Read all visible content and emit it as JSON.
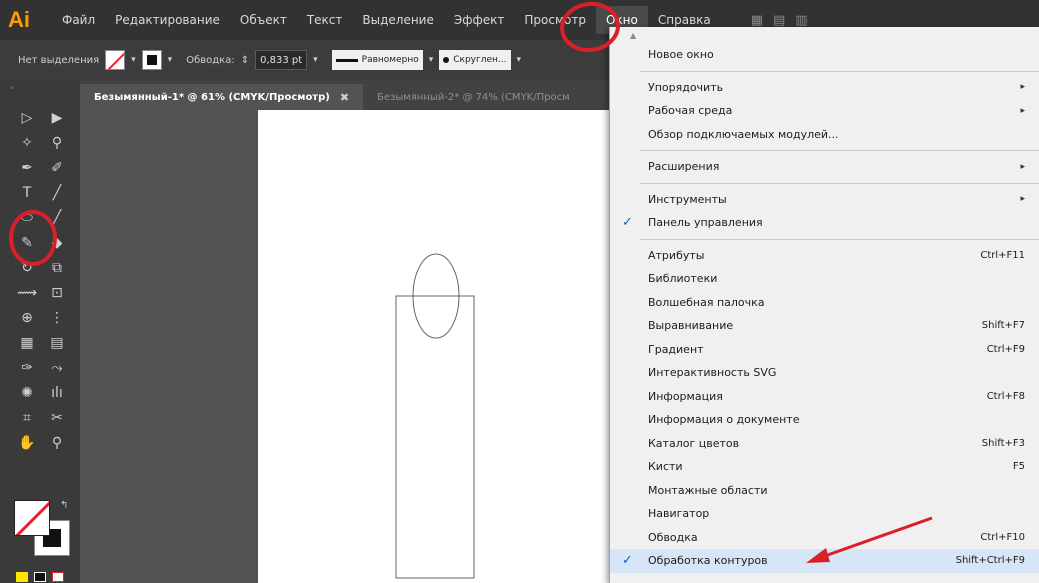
{
  "app": {
    "logo": "Ai"
  },
  "menubar": {
    "items": [
      {
        "label": "Файл",
        "active": false
      },
      {
        "label": "Редактирование",
        "active": false
      },
      {
        "label": "Объект",
        "active": false
      },
      {
        "label": "Текст",
        "active": false
      },
      {
        "label": "Выделение",
        "active": false
      },
      {
        "label": "Эффект",
        "active": false
      },
      {
        "label": "Просмотр",
        "active": false
      },
      {
        "label": "Окно",
        "active": true
      },
      {
        "label": "Справка",
        "active": false
      }
    ]
  },
  "controlbar": {
    "selection_label": "Нет выделения",
    "stroke_label": "Обводка:",
    "stroke_value": "0,833 pt",
    "profile_label": "Равномерно",
    "brush_label": "Скруглен..."
  },
  "tabs": [
    {
      "label": "Безымянный-1* @ 61% (CMYK/Просмотр)",
      "active": true,
      "close": "✖"
    },
    {
      "label": "Безымянный-2* @ 74% (CMYK/Просм",
      "active": false,
      "close": ""
    }
  ],
  "tools": {
    "grip": "\"",
    "rows": [
      {
        "left": "▷",
        "left_name": "selection-tool-icon",
        "right": "▶",
        "right_name": "direct-selection-tool-icon"
      },
      {
        "left": "✧",
        "left_name": "magic-wand-tool-icon",
        "right": "⚲",
        "right_name": "lasso-tool-icon"
      },
      {
        "left": "✒",
        "left_name": "pen-tool-icon",
        "right": "✐",
        "right_name": "curvature-tool-icon"
      },
      {
        "left": "T",
        "left_name": "type-tool-icon",
        "right": "╱",
        "right_name": "line-tool-icon"
      },
      {
        "left": "⬭",
        "left_name": "ellipse-tool-icon",
        "right": "╱",
        "right_name": "paintbrush-tool-icon"
      },
      {
        "left": "✎",
        "left_name": "shaper-tool-icon",
        "right": "◆",
        "right_name": "eraser-tool-icon"
      },
      {
        "left": "↻",
        "left_name": "rotate-tool-icon",
        "right": "⧉",
        "right_name": "scale-tool-icon"
      },
      {
        "left": "⟿",
        "left_name": "width-tool-icon",
        "right": "⊡",
        "right_name": "free-transform-tool-icon"
      },
      {
        "left": "⊕",
        "left_name": "shape-builder-tool-icon",
        "right": "⋮",
        "right_name": "perspective-tool-icon"
      },
      {
        "left": "▦",
        "left_name": "mesh-tool-icon",
        "right": "▤",
        "right_name": "gradient-tool-icon"
      },
      {
        "left": "✑",
        "left_name": "eyedropper-tool-icon",
        "right": "⤳",
        "right_name": "blend-tool-icon"
      },
      {
        "left": "✺",
        "left_name": "symbol-sprayer-tool-icon",
        "right": "ılı",
        "right_name": "column-graph-tool-icon"
      },
      {
        "left": "⌗",
        "left_name": "artboard-tool-icon",
        "right": "✂",
        "right_name": "slice-tool-icon"
      },
      {
        "left": "✋",
        "left_name": "hand-tool-icon",
        "right": "⚲",
        "right_name": "zoom-tool-icon"
      }
    ],
    "swap_glyph": "↰"
  },
  "window_menu": {
    "scroll_glyph": "▲",
    "items": [
      {
        "label": "Новое окно",
        "shortcut": "",
        "submenu": false,
        "checked": false,
        "sep_after": true
      },
      {
        "label": "Упорядочить",
        "shortcut": "",
        "submenu": true,
        "checked": false,
        "sep_after": false
      },
      {
        "label": "Рабочая среда",
        "shortcut": "",
        "submenu": true,
        "checked": false,
        "sep_after": false
      },
      {
        "label": "Обзор подключаемых модулей...",
        "shortcut": "",
        "submenu": false,
        "checked": false,
        "sep_after": true
      },
      {
        "label": "Расширения",
        "shortcut": "",
        "submenu": true,
        "checked": false,
        "sep_after": true
      },
      {
        "label": "Инструменты",
        "shortcut": "",
        "submenu": true,
        "checked": false,
        "sep_after": false
      },
      {
        "label": "Панель управления",
        "shortcut": "",
        "submenu": false,
        "checked": true,
        "sep_after": true
      },
      {
        "label": "Атрибуты",
        "shortcut": "Ctrl+F11",
        "submenu": false,
        "checked": false,
        "sep_after": false
      },
      {
        "label": "Библиотеки",
        "shortcut": "",
        "submenu": false,
        "checked": false,
        "sep_after": false
      },
      {
        "label": "Волшебная палочка",
        "shortcut": "",
        "submenu": false,
        "checked": false,
        "sep_after": false
      },
      {
        "label": "Выравнивание",
        "shortcut": "Shift+F7",
        "submenu": false,
        "checked": false,
        "sep_after": false
      },
      {
        "label": "Градиент",
        "shortcut": "Ctrl+F9",
        "submenu": false,
        "checked": false,
        "sep_after": false
      },
      {
        "label": "Интерактивность SVG",
        "shortcut": "",
        "submenu": false,
        "checked": false,
        "sep_after": false
      },
      {
        "label": "Информация",
        "shortcut": "Ctrl+F8",
        "submenu": false,
        "checked": false,
        "sep_after": false
      },
      {
        "label": "Информация о документе",
        "shortcut": "",
        "submenu": false,
        "checked": false,
        "sep_after": false
      },
      {
        "label": "Каталог цветов",
        "shortcut": "Shift+F3",
        "submenu": false,
        "checked": false,
        "sep_after": false
      },
      {
        "label": "Кисти",
        "shortcut": "F5",
        "submenu": false,
        "checked": false,
        "sep_after": false
      },
      {
        "label": "Монтажные области",
        "shortcut": "",
        "submenu": false,
        "checked": false,
        "sep_after": false
      },
      {
        "label": "Навигатор",
        "shortcut": "",
        "submenu": false,
        "checked": false,
        "sep_after": false
      },
      {
        "label": "Обводка",
        "shortcut": "Ctrl+F10",
        "submenu": false,
        "checked": false,
        "sep_after": false
      },
      {
        "label": "Обработка контуров",
        "shortcut": "Shift+Ctrl+F9",
        "submenu": false,
        "checked": true,
        "highlight": true,
        "sep_after": false
      }
    ]
  },
  "colors": {
    "annotation_red": "#d9202a",
    "menu_highlight": "#d7e6f7",
    "check_blue": "#1c5fb8"
  }
}
